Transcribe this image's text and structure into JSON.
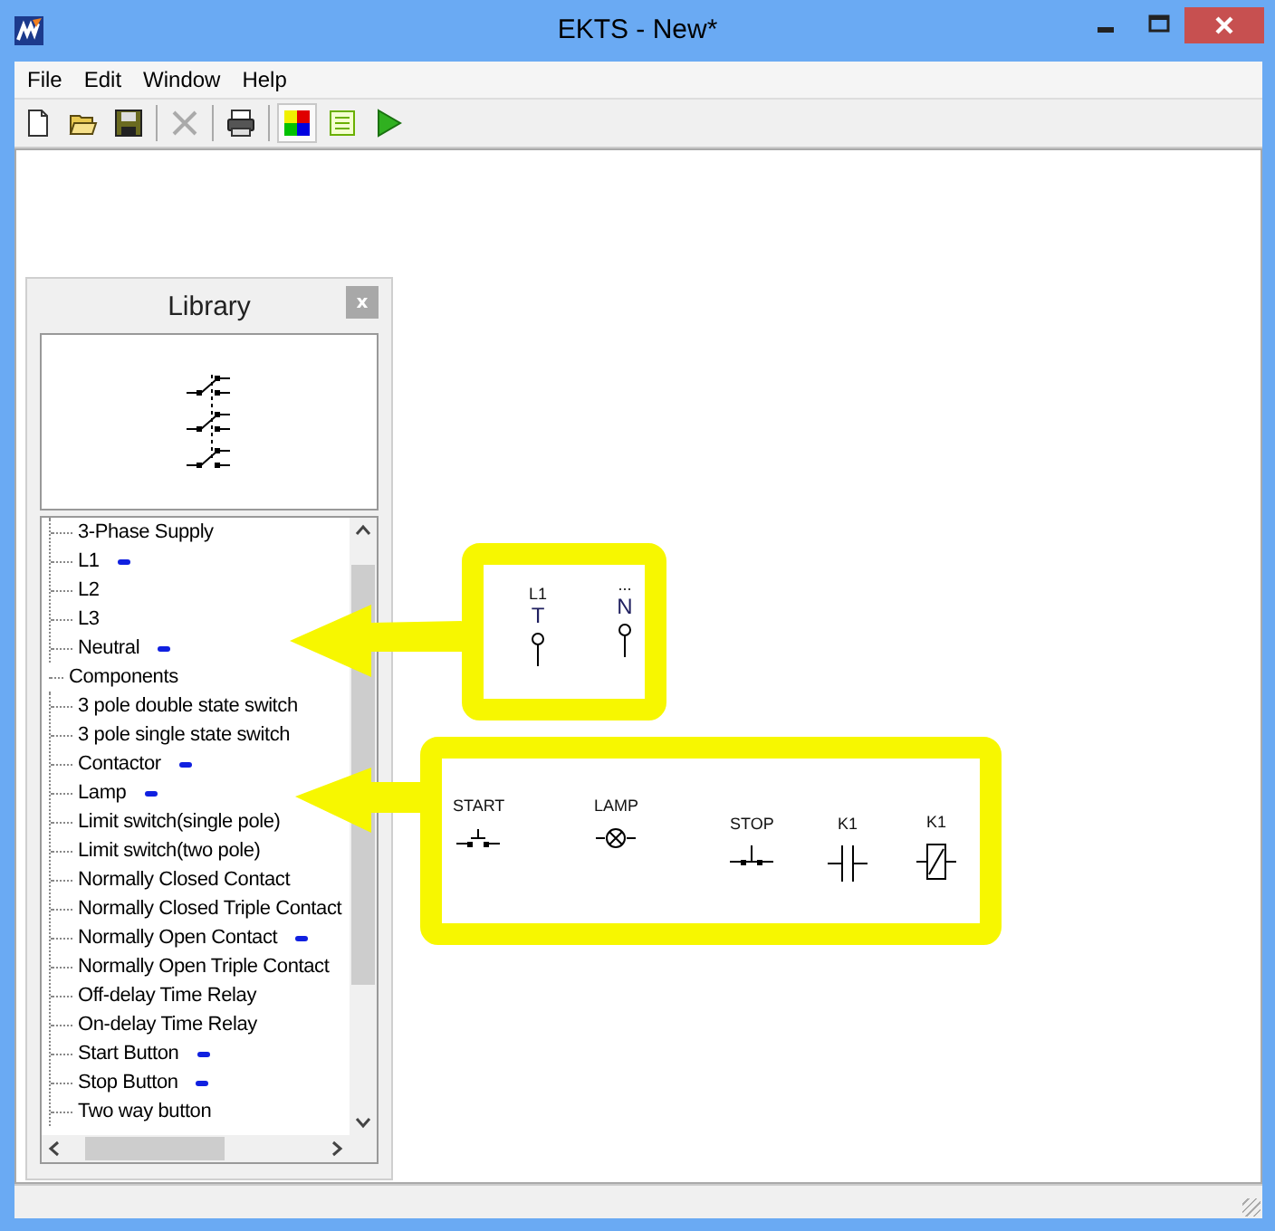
{
  "window": {
    "title": "EKTS - New*"
  },
  "menu": [
    {
      "label": "File"
    },
    {
      "label": "Edit"
    },
    {
      "label": "Window"
    },
    {
      "label": "Help"
    }
  ],
  "toolbar": [
    {
      "kind": "new",
      "disabled": false,
      "pressed": false
    },
    {
      "kind": "open",
      "disabled": false,
      "pressed": false
    },
    {
      "kind": "save",
      "disabled": false,
      "pressed": false
    },
    {
      "kind": "sep"
    },
    {
      "kind": "delete",
      "disabled": true,
      "pressed": false
    },
    {
      "kind": "sep"
    },
    {
      "kind": "print",
      "disabled": false,
      "pressed": false
    },
    {
      "kind": "sep"
    },
    {
      "kind": "colors",
      "disabled": false,
      "pressed": true
    },
    {
      "kind": "list",
      "disabled": false,
      "pressed": false
    },
    {
      "kind": "run",
      "disabled": false,
      "pressed": false
    }
  ],
  "library": {
    "title": "Library",
    "close": "x",
    "tree": [
      {
        "children": [
          {
            "label": "3-Phase Supply",
            "marked": false
          },
          {
            "label": "L1",
            "marked": true
          },
          {
            "label": "L2",
            "marked": false
          },
          {
            "label": "L3",
            "marked": false
          },
          {
            "label": "Neutral",
            "marked": true
          }
        ]
      },
      {
        "label": "Components",
        "marked": false,
        "children": [
          {
            "label": "3 pole double state switch",
            "marked": false
          },
          {
            "label": "3 pole single state switch",
            "marked": false
          },
          {
            "label": "Contactor",
            "marked": true
          },
          {
            "label": "Lamp",
            "marked": true
          },
          {
            "label": "Limit switch(single pole)",
            "marked": false
          },
          {
            "label": "Limit switch(two pole)",
            "marked": false
          },
          {
            "label": "Normally Closed Contact",
            "marked": false
          },
          {
            "label": "Normally Closed Triple Contact",
            "marked": false
          },
          {
            "label": "Normally Open Contact",
            "marked": true
          },
          {
            "label": "Normally Open Triple Contact",
            "marked": false
          },
          {
            "label": "Off-delay Time Relay",
            "marked": false
          },
          {
            "label": "On-delay Time Relay",
            "marked": false
          },
          {
            "label": "Start Button",
            "marked": true
          },
          {
            "label": "Stop Button",
            "marked": true
          },
          {
            "label": "Two way button",
            "marked": false
          }
        ]
      }
    ]
  },
  "canvas": {
    "symbols": [
      {
        "kind": "terminal",
        "labels": [
          "L1",
          "T"
        ]
      },
      {
        "kind": "terminal",
        "labels": [
          "...",
          "N"
        ]
      },
      {
        "kind": "start-button",
        "labels": [
          "START"
        ]
      },
      {
        "kind": "lamp",
        "labels": [
          "LAMP"
        ]
      },
      {
        "kind": "stop-button",
        "labels": [
          "STOP"
        ]
      },
      {
        "kind": "contact",
        "labels": [
          "K1"
        ]
      },
      {
        "kind": "coil",
        "labels": [
          "K1"
        ]
      }
    ]
  }
}
